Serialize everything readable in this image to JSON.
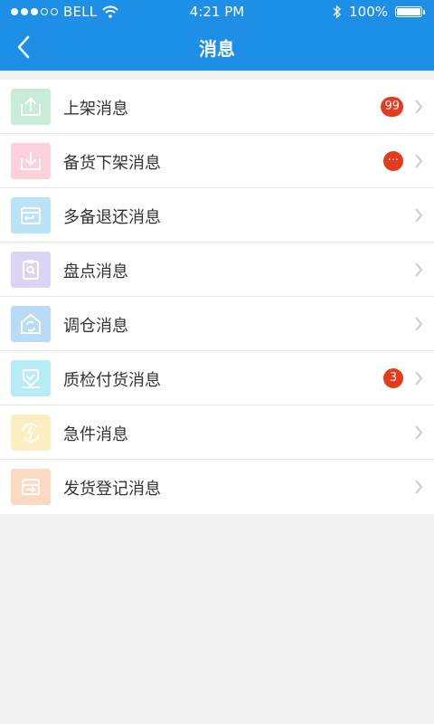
{
  "status_bar": {
    "carrier": "BELL",
    "time": "4:21 PM",
    "battery": "100%"
  },
  "navbar": {
    "title": "消息"
  },
  "list": [
    {
      "label": "上架消息",
      "badge": "99",
      "icon": "shelf-up-icon",
      "color": "#c9ecd9"
    },
    {
      "label": "备货下架消息",
      "badge": "···",
      "icon": "shelf-down-icon",
      "color": "#fcd1dc"
    },
    {
      "label": "多备退还消息",
      "badge": "",
      "icon": "return-icon",
      "color": "#b9e3f7"
    },
    {
      "label": "盘点消息",
      "badge": "",
      "icon": "inventory-icon",
      "color": "#dcd4f5"
    },
    {
      "label": "调仓消息",
      "badge": "",
      "icon": "warehouse-transfer-icon",
      "color": "#b8dcf7"
    },
    {
      "label": "质检付货消息",
      "badge": "3",
      "icon": "quality-check-icon",
      "color": "#b5ecf5"
    },
    {
      "label": "急件消息",
      "badge": "",
      "icon": "urgent-icon",
      "color": "#fdeec1"
    },
    {
      "label": "发货登记消息",
      "badge": "",
      "icon": "shipment-register-icon",
      "color": "#fcd9c2"
    }
  ],
  "colors": {
    "header": "#1e8fe6",
    "badge": "#e53a1c",
    "background": "#f2f2f2"
  }
}
